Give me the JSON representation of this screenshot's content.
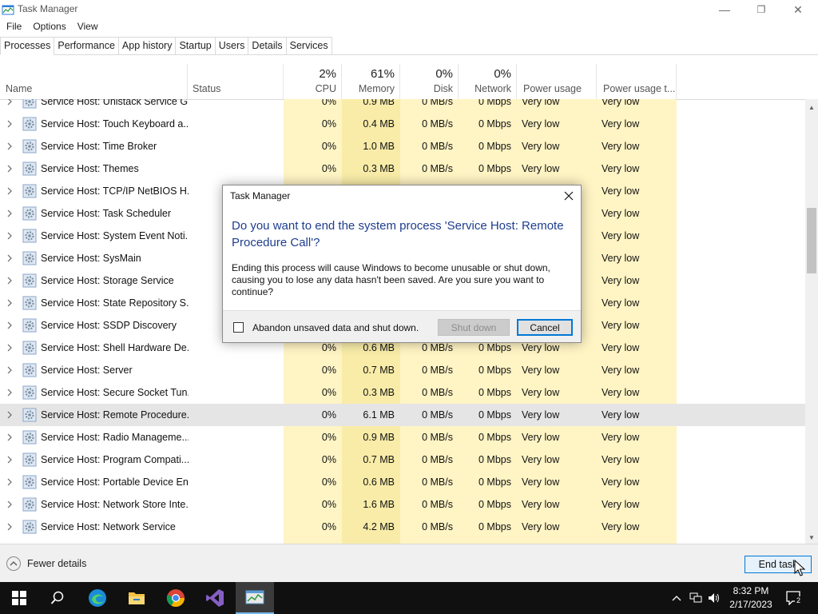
{
  "window": {
    "title": "Task Manager",
    "minimize": "—",
    "restore": "❐",
    "close": "✕"
  },
  "menu": [
    "File",
    "Options",
    "View"
  ],
  "tabs": [
    "Processes",
    "Performance",
    "App history",
    "Startup",
    "Users",
    "Details",
    "Services"
  ],
  "active_tab": "Processes",
  "columns": {
    "name": "Name",
    "status": "Status",
    "cpu": {
      "pct": "2%",
      "label": "CPU"
    },
    "memory": {
      "pct": "61%",
      "label": "Memory"
    },
    "disk": {
      "pct": "0%",
      "label": "Disk"
    },
    "network": {
      "pct": "0%",
      "label": "Network"
    },
    "power": "Power usage",
    "power_trend": "Power usage t..."
  },
  "rows": [
    {
      "name": "Service Host: Unistack Service G...",
      "cpu": "0%",
      "mem": "0.9 MB",
      "disk": "0 MB/s",
      "net": "0 Mbps",
      "power": "Very low",
      "trend": "Very low"
    },
    {
      "name": "Service Host: Touch Keyboard a...",
      "cpu": "0%",
      "mem": "0.4 MB",
      "disk": "0 MB/s",
      "net": "0 Mbps",
      "power": "Very low",
      "trend": "Very low"
    },
    {
      "name": "Service Host: Time Broker",
      "cpu": "0%",
      "mem": "1.0 MB",
      "disk": "0 MB/s",
      "net": "0 Mbps",
      "power": "Very low",
      "trend": "Very low"
    },
    {
      "name": "Service Host: Themes",
      "cpu": "0%",
      "mem": "0.3 MB",
      "disk": "0 MB/s",
      "net": "0 Mbps",
      "power": "Very low",
      "trend": "Very low"
    },
    {
      "name": "Service Host: TCP/IP NetBIOS H...",
      "cpu": "",
      "mem": "",
      "disk": "",
      "net": "",
      "power": "",
      "trend": "Very low"
    },
    {
      "name": "Service Host: Task Scheduler",
      "cpu": "",
      "mem": "",
      "disk": "",
      "net": "",
      "power": "",
      "trend": "Very low"
    },
    {
      "name": "Service Host: System Event Noti...",
      "cpu": "",
      "mem": "",
      "disk": "",
      "net": "",
      "power": "",
      "trend": "Very low"
    },
    {
      "name": "Service Host: SysMain",
      "cpu": "",
      "mem": "",
      "disk": "",
      "net": "",
      "power": "",
      "trend": "Very low"
    },
    {
      "name": "Service Host: Storage Service",
      "cpu": "",
      "mem": "",
      "disk": "",
      "net": "",
      "power": "",
      "trend": "Very low"
    },
    {
      "name": "Service Host: State Repository S...",
      "cpu": "",
      "mem": "",
      "disk": "",
      "net": "",
      "power": "",
      "trend": "Very low"
    },
    {
      "name": "Service Host: SSDP Discovery",
      "cpu": "",
      "mem": "",
      "disk": "",
      "net": "",
      "power": "",
      "trend": "Very low"
    },
    {
      "name": "Service Host: Shell Hardware De...",
      "cpu": "0%",
      "mem": "0.6 MB",
      "disk": "0 MB/s",
      "net": "0 Mbps",
      "power": "Very low",
      "trend": "Very low"
    },
    {
      "name": "Service Host: Server",
      "cpu": "0%",
      "mem": "0.7 MB",
      "disk": "0 MB/s",
      "net": "0 Mbps",
      "power": "Very low",
      "trend": "Very low"
    },
    {
      "name": "Service Host: Secure Socket Tun...",
      "cpu": "0%",
      "mem": "0.3 MB",
      "disk": "0 MB/s",
      "net": "0 Mbps",
      "power": "Very low",
      "trend": "Very low"
    },
    {
      "name": "Service Host: Remote Procedure...",
      "cpu": "0%",
      "mem": "6.1 MB",
      "disk": "0 MB/s",
      "net": "0 Mbps",
      "power": "Very low",
      "trend": "Very low",
      "selected": true
    },
    {
      "name": "Service Host: Radio Manageme...",
      "cpu": "0%",
      "mem": "0.9 MB",
      "disk": "0 MB/s",
      "net": "0 Mbps",
      "power": "Very low",
      "trend": "Very low"
    },
    {
      "name": "Service Host: Program Compati...",
      "cpu": "0%",
      "mem": "0.7 MB",
      "disk": "0 MB/s",
      "net": "0 Mbps",
      "power": "Very low",
      "trend": "Very low"
    },
    {
      "name": "Service Host: Portable Device En...",
      "cpu": "0%",
      "mem": "0.6 MB",
      "disk": "0 MB/s",
      "net": "0 Mbps",
      "power": "Very low",
      "trend": "Very low"
    },
    {
      "name": "Service Host: Network Store Inte...",
      "cpu": "0%",
      "mem": "1.6 MB",
      "disk": "0 MB/s",
      "net": "0 Mbps",
      "power": "Very low",
      "trend": "Very low"
    },
    {
      "name": "Service Host: Network Service",
      "cpu": "0%",
      "mem": "4.2 MB",
      "disk": "0 MB/s",
      "net": "0 Mbps",
      "power": "Very low",
      "trend": "Very low"
    }
  ],
  "footer": {
    "fewer_details": "Fewer details",
    "end_task": "End task"
  },
  "dialog": {
    "title": "Task Manager",
    "heading": "Do you want to end the system process 'Service Host: Remote Procedure Call'?",
    "body": "Ending this process will cause Windows to become unusable or shut down, causing you to lose any data hasn't been saved. Are you sure you want to continue?",
    "checkbox_label": "Abandon unsaved data and shut down.",
    "shutdown_label": "Shut down",
    "cancel_label": "Cancel"
  },
  "taskbar": {
    "icons": [
      "windows-start-icon",
      "search-icon",
      "edge-icon",
      "file-explorer-icon",
      "chrome-icon",
      "visual-studio-icon",
      "task-manager-icon"
    ],
    "time": "8:32 PM",
    "date": "2/17/2023",
    "notification_count": "2"
  },
  "colors": {
    "highlight_col": "#fff4c4",
    "selected_row": "#e5e5e5",
    "accent": "#0078d7",
    "dialog_heading": "#1e3d8f",
    "taskbar": "#101010"
  }
}
